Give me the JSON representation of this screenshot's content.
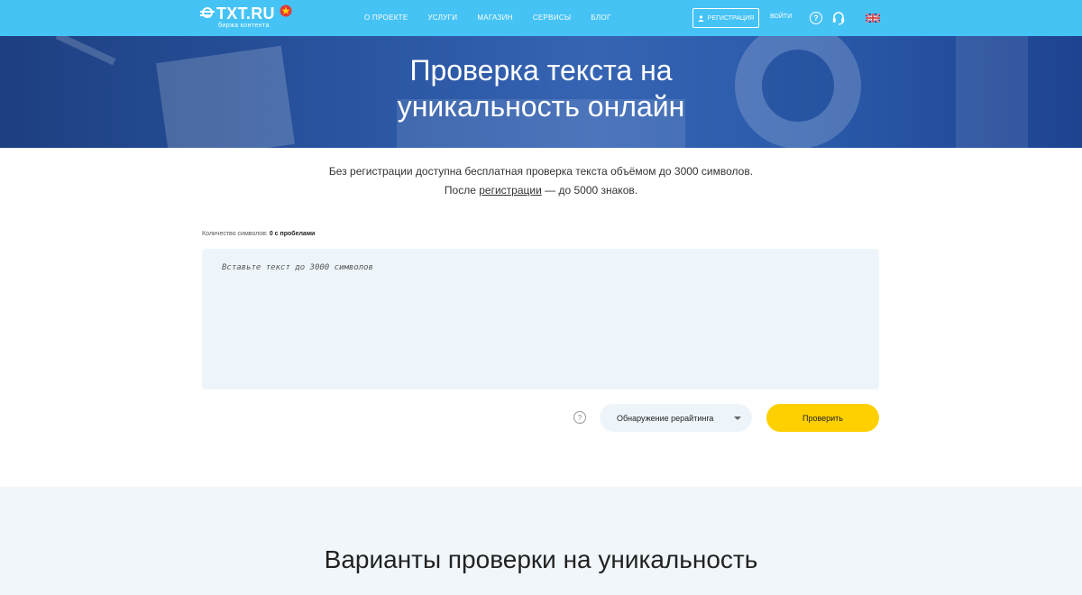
{
  "header": {
    "logo_text": "TXT.RU",
    "logo_subtext": "биржа контента",
    "nav": [
      "О ПРОЕКТЕ",
      "УСЛУГИ",
      "МАГАЗИН",
      "СЕРВИСЫ",
      "БЛОГ"
    ],
    "register_label": "РЕГИСТРАЦИЯ",
    "login_label": "ВОЙТИ",
    "help_symbol": "?",
    "icons": [
      "user-icon",
      "help-icon",
      "headset-icon",
      "uk-flag-icon"
    ],
    "colors": {
      "topbar": "#46c3f5",
      "hero": "#2a56a3",
      "accent_button": "#ffd000",
      "logo_star": "#e53935"
    }
  },
  "hero": {
    "title_line1": "Проверка текста на",
    "title_line2": "уникальность онлайн"
  },
  "intro": {
    "line1": "Без регистрации доступна бесплатная проверка текста объёмом до 3000 символов.",
    "line2_prefix": "После ",
    "line2_link": "регистрации",
    "line2_suffix": " — до 5000 знаков."
  },
  "checker": {
    "count_label": "Количество символов:",
    "count_value": "0 с пробелами",
    "textarea_placeholder": "Вставьте текст до 3000 символов",
    "hint_symbol": "?",
    "mode_selected": "Обнаружение рерайтинга",
    "check_button": "Проверить"
  },
  "variants": {
    "title": "Варианты проверки на уникальность"
  }
}
